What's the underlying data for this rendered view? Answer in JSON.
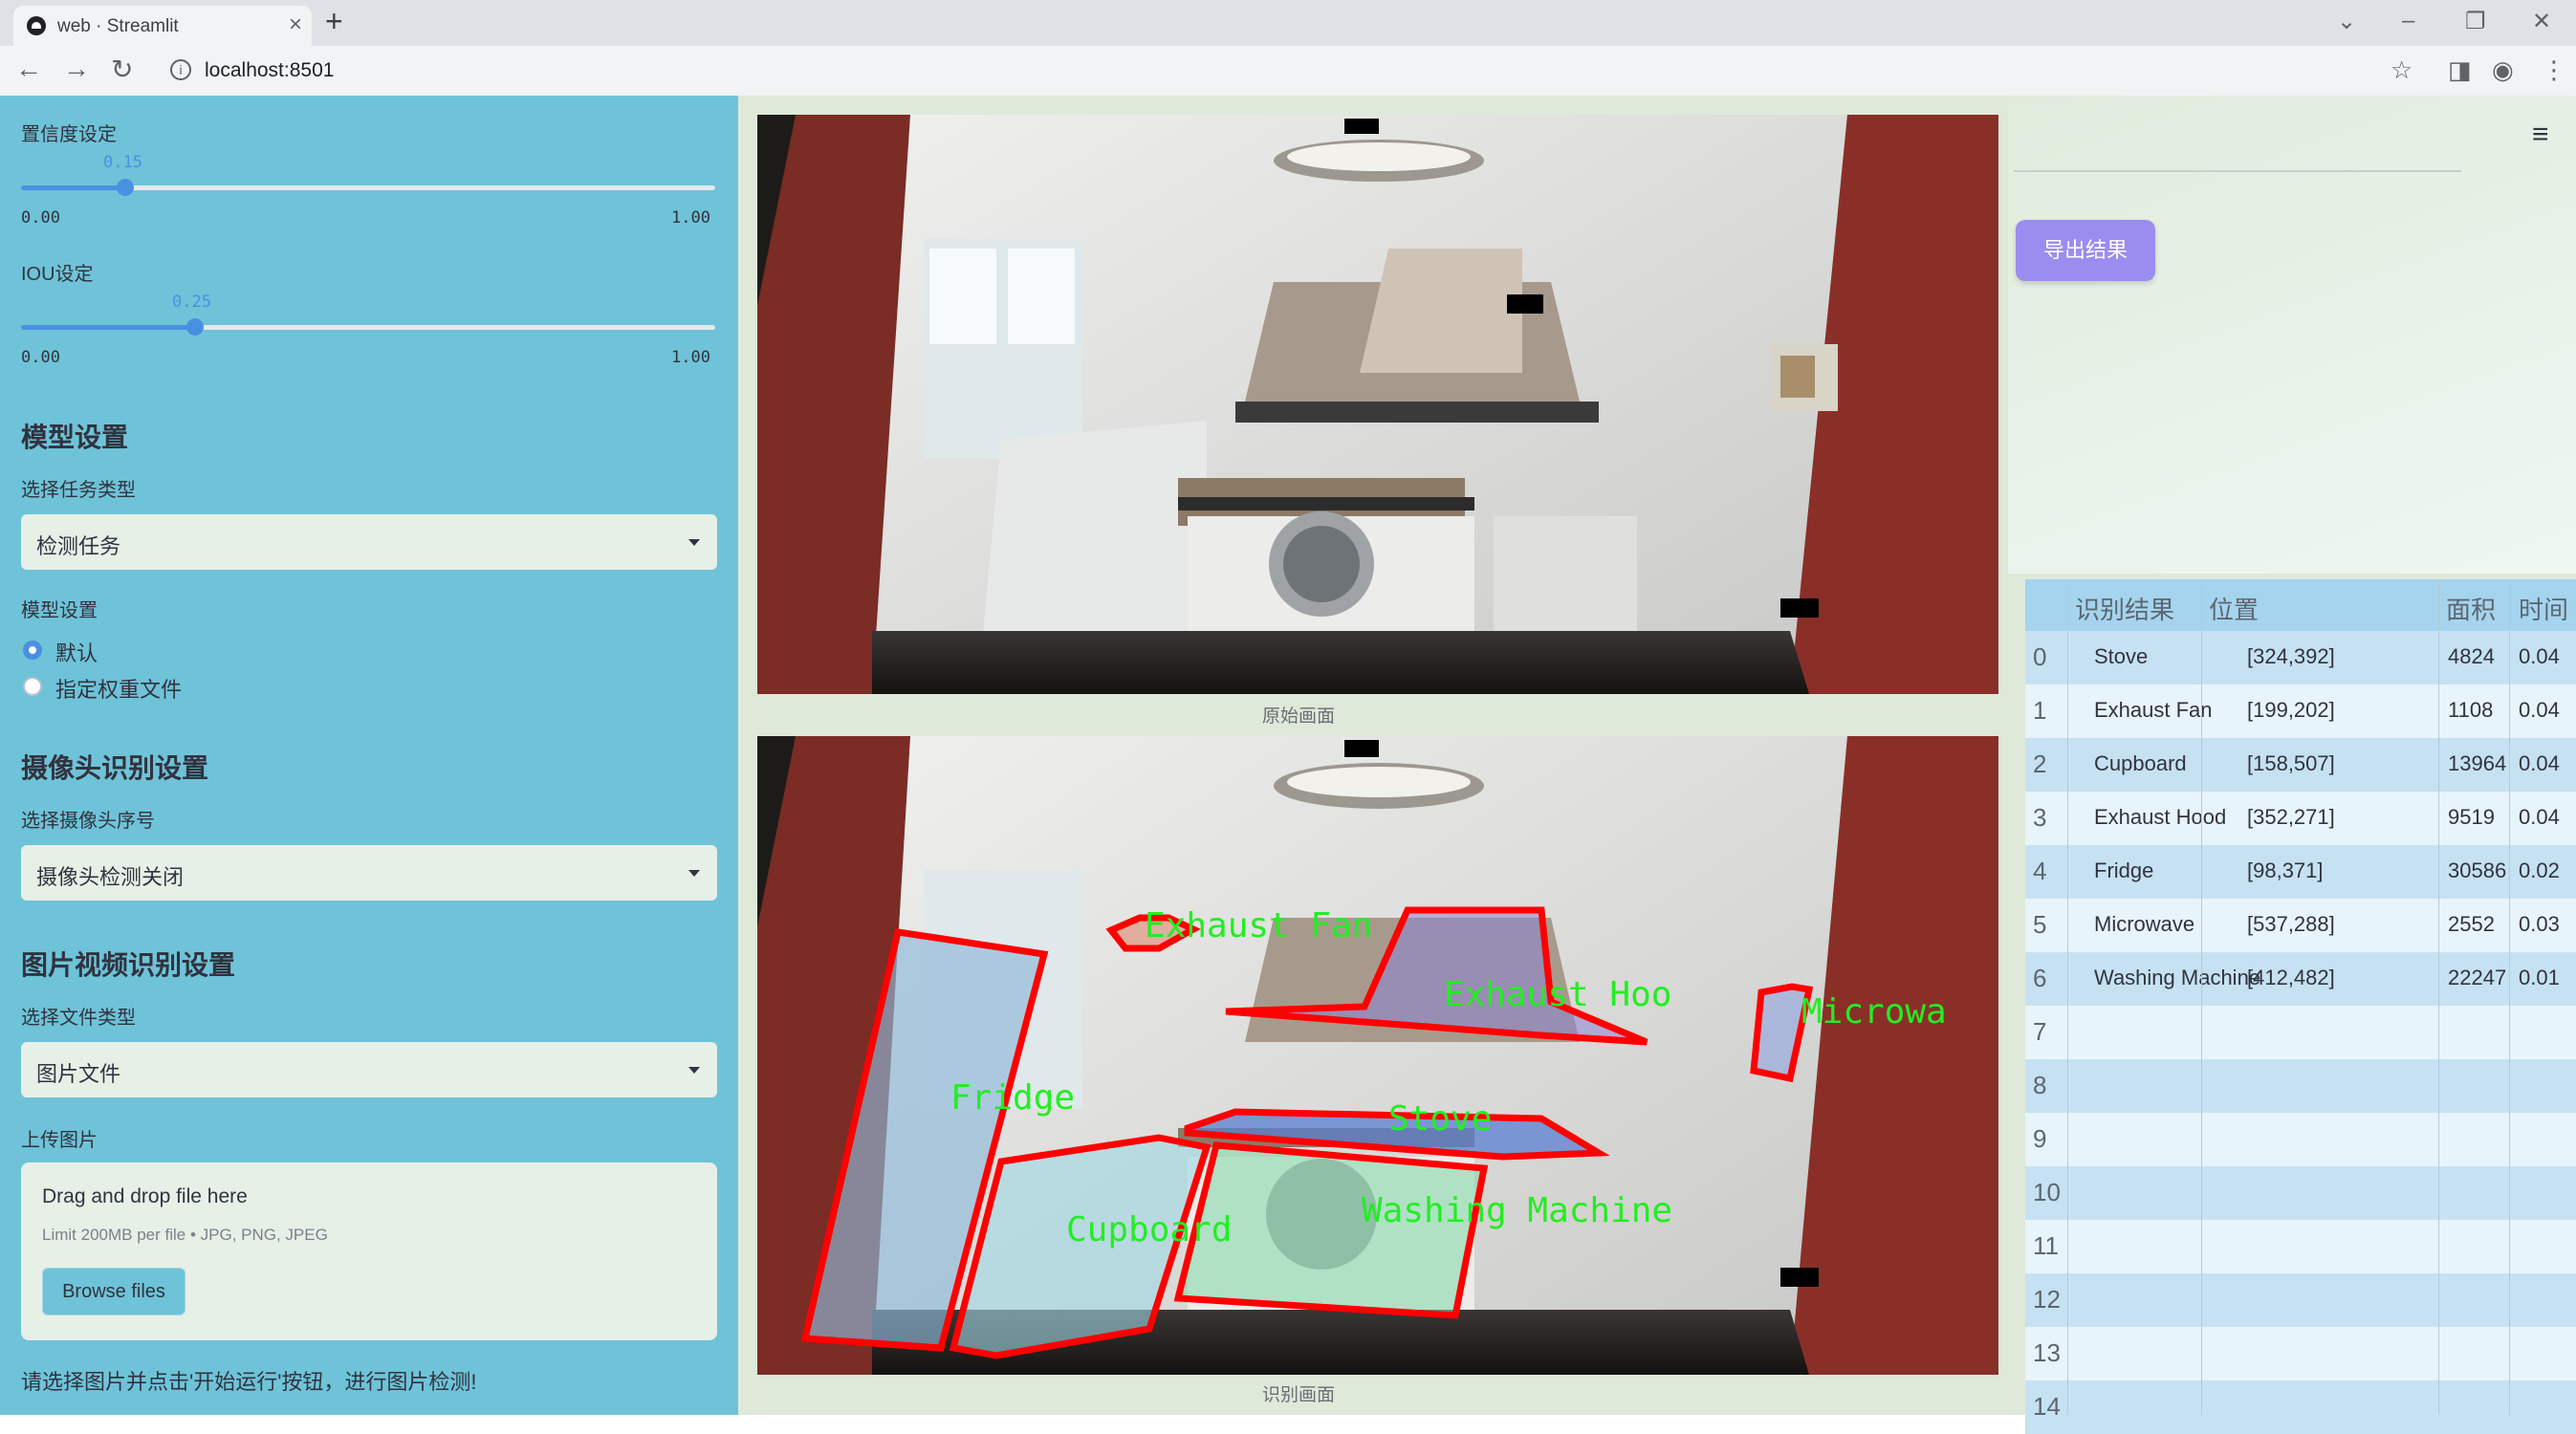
{
  "browser": {
    "tab_title": "web · Streamlit",
    "url": "localhost:8501"
  },
  "sidebar": {
    "confidence": {
      "label": "置信度设定",
      "value": "0.15",
      "value_num": 0.15,
      "min": "0.00",
      "max": "1.00"
    },
    "iou": {
      "label": "IOU设定",
      "value": "0.25",
      "value_num": 0.25,
      "min": "0.00",
      "max": "1.00"
    },
    "model_section": "模型设置",
    "task_type_label": "选择任务类型",
    "task_type_value": "检测任务",
    "model_label": "模型设置",
    "model_options": [
      "默认",
      "指定权重文件"
    ],
    "model_selected": 0,
    "camera_section": "摄像头识别设置",
    "camera_label": "选择摄像头序号",
    "camera_value": "摄像头检测关闭",
    "media_section": "图片视频识别设置",
    "file_type_label": "选择文件类型",
    "file_type_value": "图片文件",
    "upload_label": "上传图片",
    "upload_drag": "Drag and drop file here",
    "upload_limit": "Limit 200MB per file • JPG, PNG, JPEG",
    "browse_label": "Browse files",
    "hint": "请选择图片并点击'开始运行'按钮，进行图片检测!"
  },
  "main": {
    "original_caption": "原始画面",
    "result_caption": "识别画面",
    "export_label": "导出结果",
    "menu_icon": "hamburger-icon"
  },
  "detections": {
    "labels": [
      "Exhaust Fan",
      "Exhaust Hood",
      "Microwave",
      "Fridge",
      "Stove",
      "Cupboard",
      "Washing Machine"
    ],
    "label_visible": [
      "Exhaust Fan",
      "Exhaust Hoo",
      "Microwa",
      "Fridge",
      "Stove",
      "Cupboard",
      "Washing Machine"
    ],
    "box_color": "#ff0000",
    "label_color": "#22ee22"
  },
  "table": {
    "headers": [
      "识别结果",
      "位置",
      "面积",
      "时间"
    ],
    "rows": [
      {
        "idx": "0",
        "name": "Stove",
        "pos": "[324,392]",
        "area": "4824",
        "time": "0.04"
      },
      {
        "idx": "1",
        "name": "Exhaust Fan",
        "pos": "[199,202]",
        "area": "1108",
        "time": "0.04"
      },
      {
        "idx": "2",
        "name": "Cupboard",
        "pos": "[158,507]",
        "area": "13964",
        "time": "0.04"
      },
      {
        "idx": "3",
        "name": "Exhaust Hood",
        "pos": "[352,271]",
        "area": "9519",
        "time": "0.04"
      },
      {
        "idx": "4",
        "name": "Fridge",
        "pos": "[98,371]",
        "area": "30586",
        "time": "0.02"
      },
      {
        "idx": "5",
        "name": "Microwave",
        "pos": "[537,288]",
        "area": "2552",
        "time": "0.03"
      },
      {
        "idx": "6",
        "name": "Washing Machine",
        "pos": "[412,482]",
        "area": "22247",
        "time": "0.01"
      },
      {
        "idx": "7",
        "name": "",
        "pos": "",
        "area": "",
        "time": ""
      },
      {
        "idx": "8",
        "name": "",
        "pos": "",
        "area": "",
        "time": ""
      },
      {
        "idx": "9",
        "name": "",
        "pos": "",
        "area": "",
        "time": ""
      },
      {
        "idx": "10",
        "name": "",
        "pos": "",
        "area": "",
        "time": ""
      },
      {
        "idx": "11",
        "name": "",
        "pos": "",
        "area": "",
        "time": ""
      },
      {
        "idx": "12",
        "name": "",
        "pos": "",
        "area": "",
        "time": ""
      },
      {
        "idx": "13",
        "name": "",
        "pos": "",
        "area": "",
        "time": ""
      },
      {
        "idx": "14",
        "name": "",
        "pos": "",
        "area": "",
        "time": ""
      }
    ]
  },
  "colors": {
    "sidebar_bg": "#6ec3d8",
    "accent": "#4a90e2",
    "export_button": "#9b8cf0",
    "table_header": "#a5d4ee"
  }
}
